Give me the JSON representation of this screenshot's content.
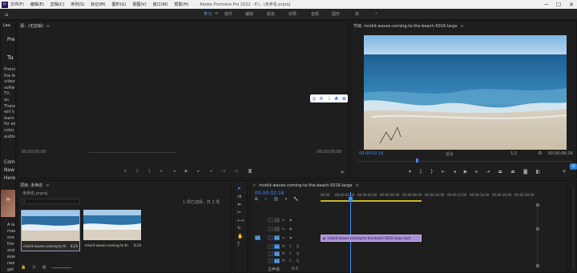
{
  "app": {
    "title": "Adobe Premiere Pro 2022 - E:\\...\\未命名.prproj",
    "menu": [
      "文件(F)",
      "编辑(E)",
      "剪辑(C)",
      "序列(S)",
      "标记(M)",
      "图形(G)",
      "视图(V)",
      "窗口(W)",
      "帮助(H)"
    ]
  },
  "workspaces": {
    "tabs": [
      "学习",
      "组件",
      "编辑",
      "颜色",
      "效果",
      "音频",
      "图形",
      "库"
    ],
    "active_index": 0,
    "more": "»"
  },
  "learn_panel": {
    "tab": "Lea",
    "heading1": "Pre",
    "heading2": "Tu",
    "lines": [
      "Premi",
      "the le",
      "video",
      "softw",
      "TV, an",
      "These",
      "will h",
      "learn",
      "for ed",
      "color,",
      "audio"
    ],
    "lines2": [
      "Comp",
      "New",
      "Here"
    ],
    "lines3": [
      "A le",
      "mas",
      "ove",
      "the",
      "and",
      "esse",
      "nee",
      "get"
    ]
  },
  "source_panel": {
    "title": "源：(无剪辑)",
    "timecode_left": "00;00;00;00",
    "timecode_right": "00;00;00;00"
  },
  "program_panel": {
    "title": "节目: mixkit-waves-coming-to-the-beach-5016-large",
    "timecode_left": "00:00:02:16",
    "fit": "适合",
    "quality": "1/2",
    "timecode_right": "00:00:08:29"
  },
  "overlay_toolbar": {
    "items": [
      "select-icon",
      "text-icon",
      "crescent-icon",
      "shapes-icon",
      "settings-icon"
    ],
    "text_label": "A"
  },
  "project_panel": {
    "title": "项目: 未命名",
    "filename": "未命名.prproj",
    "selection": "1 项已选择，共 2 项",
    "clips": [
      {
        "name": "mixkit-waves-coming-to-the...",
        "duration": "8;29"
      },
      {
        "name": "mixkit-waves-coming-to-the...",
        "duration": "8;29"
      }
    ]
  },
  "timeline": {
    "title": "mixkit-waves-coming-to-the-beach-5016-large",
    "timecode": "00:00:02:16",
    "ruler": [
      "00:00",
      "00:00:02:00",
      "00:00:04:00",
      "00:00:06:00",
      "00:00:08:00",
      "00:00:10:00",
      "00:00:12:00",
      "00:00:14:00",
      "00:00:16:00",
      "00:00:18:00"
    ],
    "tracks": [
      {
        "src": "",
        "id": "V3"
      },
      {
        "src": "",
        "id": "V2"
      },
      {
        "src": "V1",
        "id": "V1"
      },
      {
        "src": "",
        "id": "A1"
      },
      {
        "src": "",
        "id": "A2"
      },
      {
        "src": "",
        "id": "A3"
      }
    ],
    "clip_label": "mixkit-waves-coming-to-the-beach-5016-large.mp4",
    "master": "主声道",
    "master_value": "0.0",
    "playhead_fraction": 0.132,
    "clip_end_fraction": 0.445
  },
  "colors": {
    "accent": "#3d8cff",
    "clip": "#a98fd6",
    "ws_active": "#5aa3ff"
  }
}
